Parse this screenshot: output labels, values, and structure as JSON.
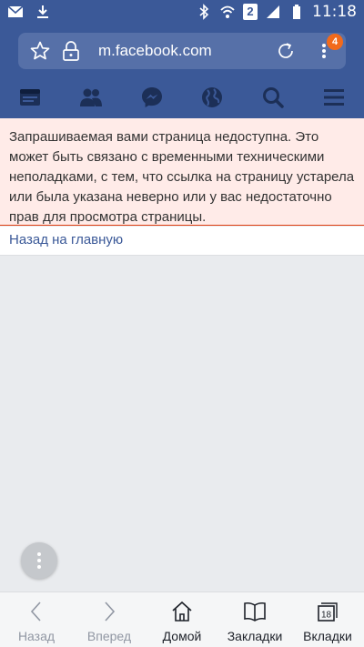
{
  "status_bar": {
    "time": "11:18",
    "sim": "2",
    "icons": [
      "mail-icon",
      "download-icon",
      "bluetooth-icon",
      "wifi-icon",
      "signal-icon",
      "battery-icon"
    ]
  },
  "browser": {
    "url": "m.facebook.com",
    "menu_badge": "4"
  },
  "fb_nav": {
    "items": [
      "news-feed-icon",
      "friends-icon",
      "messenger-icon",
      "globe-icon",
      "search-icon",
      "menu-icon"
    ]
  },
  "error": {
    "message": "Запрашиваемая вами страница недоступна. Это может быть связано с временными техническими неполадками, с тем, что ссылка на страницу устарела или была указана неверно или у вас недостаточно прав для просмотра страницы."
  },
  "home_link": "Назад на главную",
  "bottom_bar": {
    "back": "Назад",
    "forward": "Вперед",
    "home": "Домой",
    "bookmarks": "Закладки",
    "tabs": "Вкладки",
    "tabs_count": "18"
  },
  "colors": {
    "facebook_blue": "#3b5998",
    "error_bg": "#ffebe8",
    "badge": "#f26a1b"
  }
}
